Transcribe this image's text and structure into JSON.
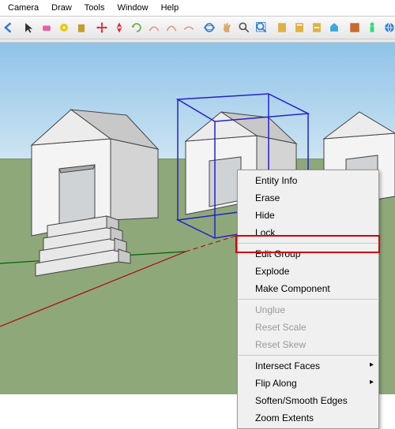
{
  "menu": {
    "items": [
      "Camera",
      "Draw",
      "Tools",
      "Window",
      "Help"
    ]
  },
  "toolbar_icons": [
    {
      "name": "back-arrow-icon",
      "color": "#2a7bd3"
    },
    {
      "name": "select-icon",
      "color": "#333"
    },
    {
      "name": "eraser-icon",
      "color": "#e85fa8"
    },
    {
      "name": "tape-icon",
      "color": "#e8c800"
    },
    {
      "name": "paint-icon",
      "color": "#c99b2f"
    },
    {
      "name": "move-icon",
      "color": "#d23"
    },
    {
      "name": "nav-icon",
      "color": "#d23"
    },
    {
      "name": "rotate-icon",
      "color": "#6a4"
    },
    {
      "name": "arc1-icon",
      "color": "#d98"
    },
    {
      "name": "arc2-icon",
      "color": "#d98"
    },
    {
      "name": "arc3-icon",
      "color": "#d98"
    },
    {
      "name": "orbit-icon",
      "color": "#2a7bd3"
    },
    {
      "name": "pan-icon",
      "color": "#d9a86a"
    },
    {
      "name": "zoom-icon",
      "color": "#555"
    },
    {
      "name": "zoom-extents-icon",
      "color": "#2a7bd3"
    },
    {
      "name": "doc1-icon",
      "color": "#e0b040"
    },
    {
      "name": "doc2-icon",
      "color": "#e0b040"
    },
    {
      "name": "doc3-icon",
      "color": "#e0b040"
    },
    {
      "name": "component-icon",
      "color": "#3aa6dd"
    },
    {
      "name": "texture-icon",
      "color": "#c9682f"
    },
    {
      "name": "figure-icon",
      "color": "#3d7"
    },
    {
      "name": "globe-icon",
      "color": "#2a7bd3"
    },
    {
      "name": "filter-icon",
      "color": "#888"
    }
  ],
  "context_menu": {
    "items": [
      {
        "label": "Entity Info",
        "enabled": true,
        "sub": false
      },
      {
        "label": "Erase",
        "enabled": true,
        "sub": false
      },
      {
        "label": "Hide",
        "enabled": true,
        "sub": false
      },
      {
        "label": "Lock",
        "enabled": true,
        "sub": false
      },
      {
        "sep": true
      },
      {
        "label": "Edit Group",
        "enabled": true,
        "sub": false,
        "highlight": true
      },
      {
        "label": "Explode",
        "enabled": true,
        "sub": false
      },
      {
        "label": "Make Component",
        "enabled": true,
        "sub": false
      },
      {
        "sep": true
      },
      {
        "label": "Unglue",
        "enabled": false,
        "sub": false
      },
      {
        "label": "Reset Scale",
        "enabled": false,
        "sub": false
      },
      {
        "label": "Reset Skew",
        "enabled": false,
        "sub": false
      },
      {
        "sep": true
      },
      {
        "label": "Intersect Faces",
        "enabled": true,
        "sub": true
      },
      {
        "label": "Flip Along",
        "enabled": true,
        "sub": true
      },
      {
        "label": "Soften/Smooth Edges",
        "enabled": true,
        "sub": false
      },
      {
        "label": "Zoom Extents",
        "enabled": true,
        "sub": false
      }
    ]
  },
  "colors": {
    "selection": "#2222cc",
    "axis_red": "#b00000",
    "axis_green": "#006400",
    "axis_blue": "#0000c0",
    "house_light": "#f4f4f4",
    "house_mid": "#dcdcdc",
    "house_dark": "#bcbcbc",
    "edge": "#444"
  }
}
